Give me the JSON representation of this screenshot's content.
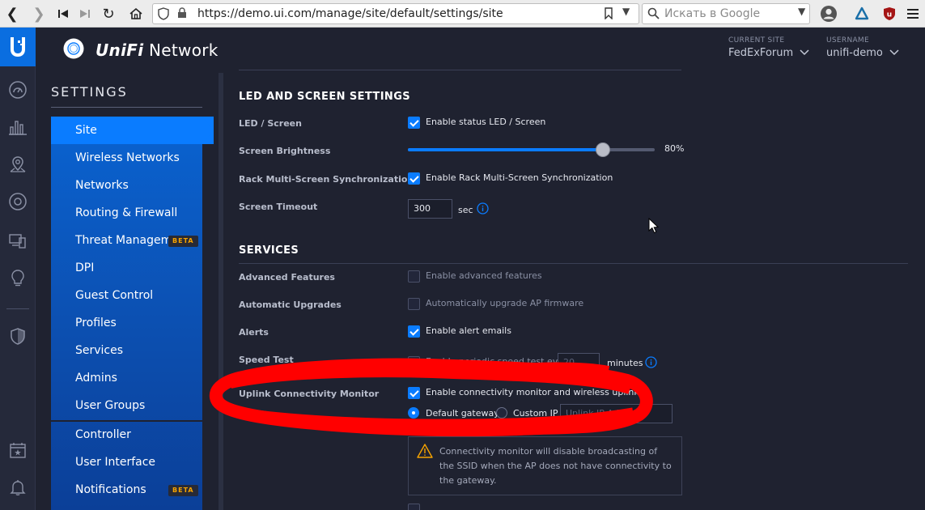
{
  "browser": {
    "url": "https://demo.ui.com/manage/site/default/settings/site",
    "search_placeholder": "Искать в Google"
  },
  "header": {
    "brand_ui": "UniFi",
    "brand_net": "Network",
    "current_site_label": "CURRENT SITE",
    "current_site_value": "FedExForum",
    "username_label": "USERNAME",
    "username_value": "unifi-demo"
  },
  "rail_icons": [
    "ubiquiti-logo-icon",
    "dashboard-icon",
    "statistics-icon",
    "map-icon",
    "devices-icon",
    "clients-icon",
    "insights-icon",
    "security-shield-icon",
    "events-icon",
    "alerts-bell-icon"
  ],
  "menu": {
    "title": "SETTINGS",
    "items": [
      {
        "label": "Site",
        "active": true,
        "beta": false
      },
      {
        "label": "Wireless Networks",
        "active": false,
        "beta": false
      },
      {
        "label": "Networks",
        "active": false,
        "beta": false
      },
      {
        "label": "Routing & Firewall",
        "active": false,
        "beta": false
      },
      {
        "label": "Threat Management",
        "active": false,
        "beta": true
      },
      {
        "label": "DPI",
        "active": false,
        "beta": false
      },
      {
        "label": "Guest Control",
        "active": false,
        "beta": false
      },
      {
        "label": "Profiles",
        "active": false,
        "beta": false
      },
      {
        "label": "Services",
        "active": false,
        "beta": false
      },
      {
        "label": "Admins",
        "active": false,
        "beta": false
      },
      {
        "label": "User Groups",
        "active": false,
        "beta": false
      },
      {
        "label": "Controller",
        "active": false,
        "beta": false
      },
      {
        "label": "User Interface",
        "active": false,
        "beta": false
      },
      {
        "label": "Notifications",
        "active": false,
        "beta": true
      }
    ],
    "beta_label": "BETA"
  },
  "led": {
    "title": "LED AND SCREEN SETTINGS",
    "led_label": "LED / Screen",
    "led_checkbox": "Enable status LED / Screen",
    "led_checked": true,
    "brightness_label": "Screen Brightness",
    "brightness_percent": 80,
    "brightness_text": "80%",
    "rack_label": "Rack Multi-Screen Synchronization",
    "rack_checkbox": "Enable Rack Multi-Screen Synchronization",
    "rack_checked": true,
    "timeout_label": "Screen Timeout",
    "timeout_value": "300",
    "timeout_unit": "sec"
  },
  "services": {
    "title": "SERVICES",
    "advanced_label": "Advanced Features",
    "advanced_checkbox": "Enable advanced features",
    "advanced_checked": false,
    "upgrades_label": "Automatic Upgrades",
    "upgrades_checkbox": "Automatically upgrade AP firmware",
    "upgrades_checked": false,
    "alerts_label": "Alerts",
    "alerts_checkbox": "Enable alert emails",
    "alerts_checked": true,
    "speed_label": "Speed Test",
    "speed_checkbox": "Enable periodic speed test every",
    "speed_checked": false,
    "speed_value": "20",
    "speed_unit": "minutes",
    "uplink_label": "Uplink Connectivity Monitor",
    "uplink_checkbox": "Enable connectivity monitor and wireless uplink",
    "uplink_checked": true,
    "default_gateway": "Default gateway",
    "custom_ip": "Custom IP",
    "uplink_ip_placeholder": "Uplink IP Address",
    "warning": "Connectivity monitor will disable broadcasting of the SSID when the AP does not have connectivity to the gateway."
  },
  "colors": {
    "accent": "#0a7cff",
    "annotation": "#ff0000",
    "warning": "#f7a400"
  }
}
